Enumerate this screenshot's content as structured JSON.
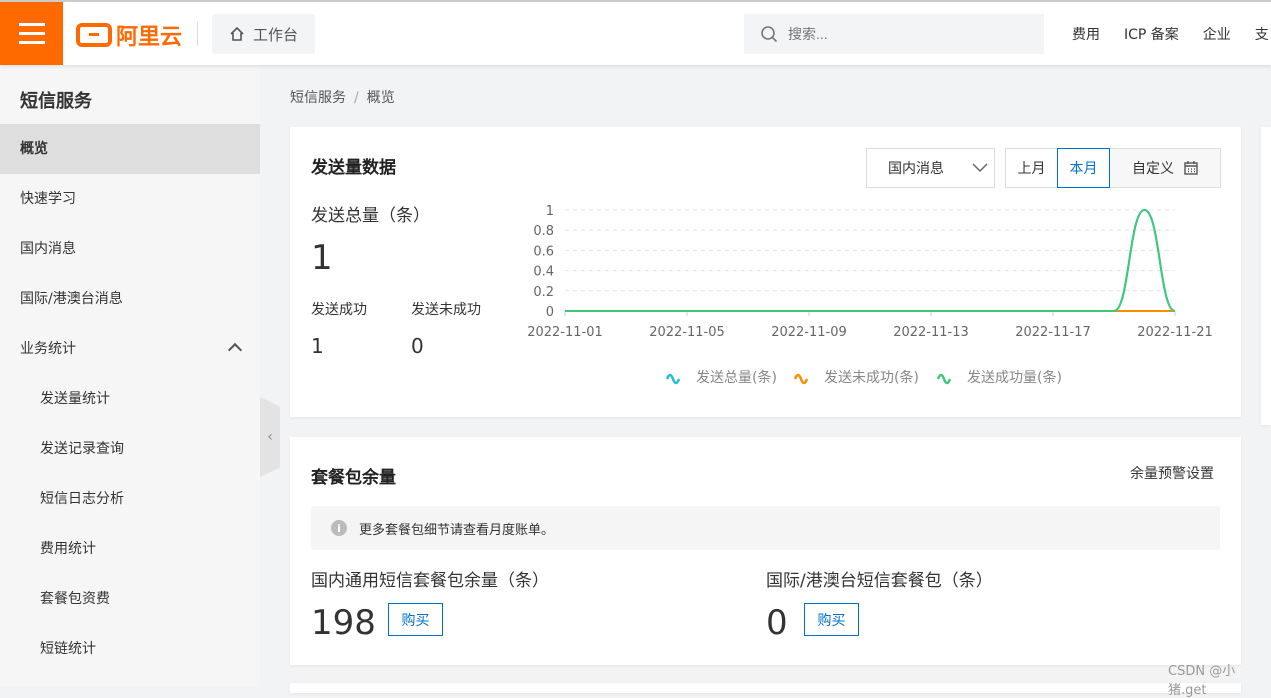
{
  "header": {
    "logo": "阿里云",
    "workspace": "工作台",
    "search_placeholder": "搜索...",
    "nav": [
      "费用",
      "ICP 备案",
      "企业",
      "支"
    ]
  },
  "sidebar": {
    "title": "短信服务",
    "items": [
      {
        "label": "概览",
        "active": true,
        "sub": false
      },
      {
        "label": "快速学习",
        "sub": false
      },
      {
        "label": "国内消息",
        "sub": false
      },
      {
        "label": "国际/港澳台消息",
        "sub": false
      },
      {
        "label": "业务统计",
        "sub": false,
        "expanded": true
      },
      {
        "label": "发送量统计",
        "sub": true
      },
      {
        "label": "发送记录查询",
        "sub": true
      },
      {
        "label": "短信日志分析",
        "sub": true
      },
      {
        "label": "费用统计",
        "sub": true
      },
      {
        "label": "套餐包资费",
        "sub": true
      },
      {
        "label": "短链统计",
        "sub": true
      }
    ]
  },
  "breadcrumb": [
    "短信服务",
    "概览"
  ],
  "send_card": {
    "title": "发送量数据",
    "select": "国内消息",
    "periods": [
      "上月",
      "本月",
      "自定义"
    ],
    "active_period": "本月",
    "total_label": "发送总量（条）",
    "total": "1",
    "success_label": "发送成功",
    "success": "1",
    "fail_label": "发送未成功",
    "fail": "0"
  },
  "chart_data": {
    "type": "line",
    "x": [
      "2022-11-01",
      "2022-11-02",
      "2022-11-03",
      "2022-11-04",
      "2022-11-05",
      "2022-11-06",
      "2022-11-07",
      "2022-11-08",
      "2022-11-09",
      "2022-11-10",
      "2022-11-11",
      "2022-11-12",
      "2022-11-13",
      "2022-11-14",
      "2022-11-15",
      "2022-11-16",
      "2022-11-17",
      "2022-11-18",
      "2022-11-19",
      "2022-11-20",
      "2022-11-21"
    ],
    "xticks": [
      "2022-11-01",
      "2022-11-05",
      "2022-11-09",
      "2022-11-13",
      "2022-11-17",
      "2022-11-21"
    ],
    "yticks": [
      "0",
      "0.2",
      "0.4",
      "0.6",
      "0.8",
      "1"
    ],
    "ylim": [
      0,
      1
    ],
    "grid": true,
    "legend": "bottom",
    "series": [
      {
        "name": "发送总量(条)",
        "color": "#1ec0d8",
        "values": [
          0,
          0,
          0,
          0,
          0,
          0,
          0,
          0,
          0,
          0,
          0,
          0,
          0,
          0,
          0,
          0,
          0,
          0,
          0,
          1,
          0
        ]
      },
      {
        "name": "发送未成功(条)",
        "color": "#ff8c00",
        "values": [
          0,
          0,
          0,
          0,
          0,
          0,
          0,
          0,
          0,
          0,
          0,
          0,
          0,
          0,
          0,
          0,
          0,
          0,
          0,
          0,
          0
        ]
      },
      {
        "name": "发送成功量(条)",
        "color": "#3fc77a",
        "values": [
          0,
          0,
          0,
          0,
          0,
          0,
          0,
          0,
          0,
          0,
          0,
          0,
          0,
          0,
          0,
          0,
          0,
          0,
          0,
          1,
          0
        ]
      }
    ]
  },
  "package_card": {
    "title": "套餐包余量",
    "alert_link": "余量预警设置",
    "tip": "更多套餐包细节请查看月度账单。",
    "domestic_label": "国内通用短信套餐包余量（条）",
    "domestic": "198",
    "intl_label": "国际/港澳台短信套餐包（条）",
    "intl": "0",
    "buy": "购买"
  },
  "watermark": "CSDN @小猪.get"
}
